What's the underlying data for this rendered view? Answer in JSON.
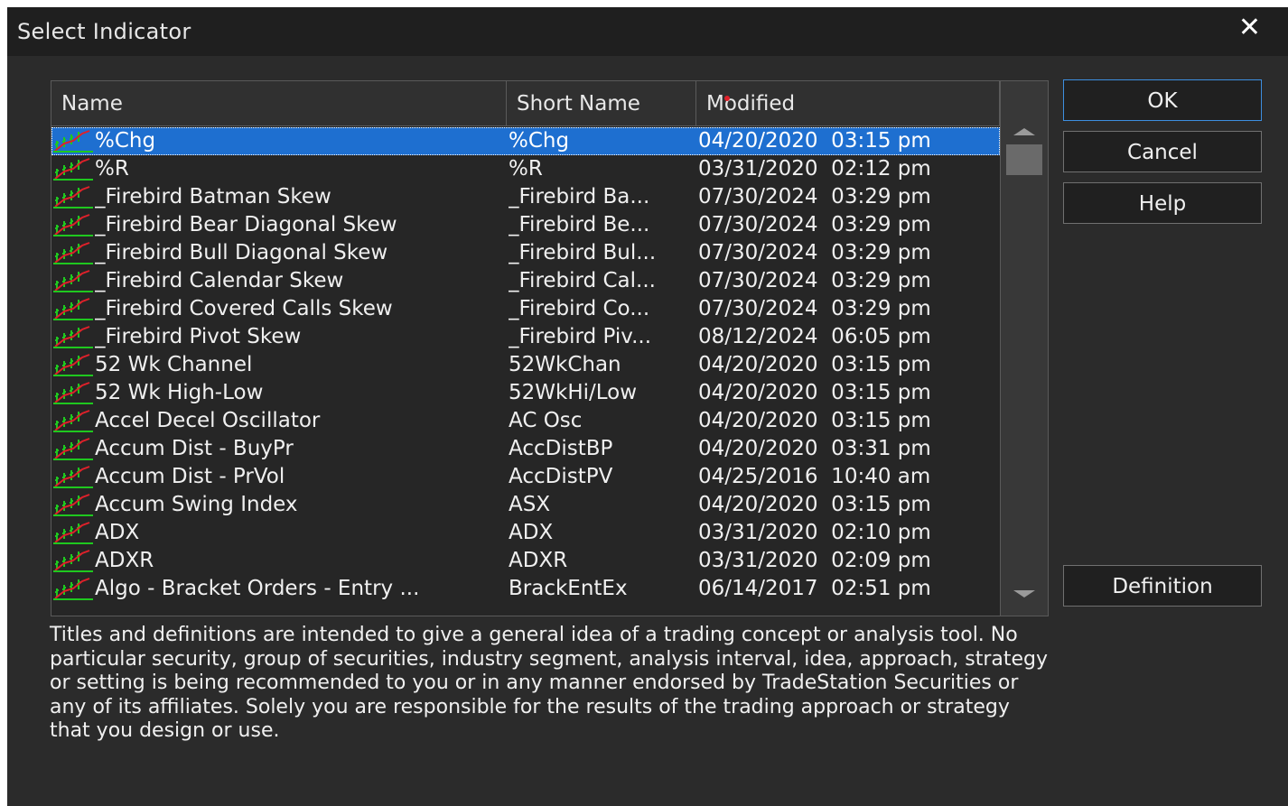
{
  "dialog": {
    "title": "Select Indicator",
    "close_glyph": "✕"
  },
  "columns": {
    "name": "Name",
    "short_name": "Short Name",
    "modified": "Modified"
  },
  "rows": [
    {
      "name": "%Chg",
      "short": "%Chg",
      "modified": "04/20/2020  03:15 pm",
      "selected": true
    },
    {
      "name": "%R",
      "short": "%R",
      "modified": "03/31/2020  02:12 pm"
    },
    {
      "name": "_Firebird Batman Skew",
      "short": "_Firebird Ba...",
      "modified": "07/30/2024  03:29 pm"
    },
    {
      "name": "_Firebird Bear Diagonal Skew",
      "short": "_Firebird Be...",
      "modified": "07/30/2024  03:29 pm"
    },
    {
      "name": "_Firebird Bull Diagonal Skew",
      "short": "_Firebird Bul...",
      "modified": "07/30/2024  03:29 pm"
    },
    {
      "name": "_Firebird Calendar Skew",
      "short": "_Firebird Cal...",
      "modified": "07/30/2024  03:29 pm"
    },
    {
      "name": "_Firebird Covered Calls Skew",
      "short": "_Firebird Co...",
      "modified": "07/30/2024  03:29 pm"
    },
    {
      "name": "_Firebird Pivot Skew",
      "short": "_Firebird Piv...",
      "modified": "08/12/2024  06:05 pm"
    },
    {
      "name": "52 Wk Channel",
      "short": "52WkChan",
      "modified": "04/20/2020  03:15 pm"
    },
    {
      "name": "52 Wk High-Low",
      "short": "52WkHi/Low",
      "modified": "04/20/2020  03:15 pm"
    },
    {
      "name": "Accel Decel Oscillator",
      "short": "AC Osc",
      "modified": "04/20/2020  03:15 pm"
    },
    {
      "name": "Accum Dist - BuyPr",
      "short": "AccDistBP",
      "modified": "04/20/2020  03:31 pm"
    },
    {
      "name": "Accum Dist - PrVol",
      "short": "AccDistPV",
      "modified": "04/25/2016  10:40 am"
    },
    {
      "name": "Accum Swing Index",
      "short": "ASX",
      "modified": "04/20/2020  03:15 pm"
    },
    {
      "name": "ADX",
      "short": "ADX",
      "modified": "03/31/2020  02:10 pm"
    },
    {
      "name": "ADXR",
      "short": "ADXR",
      "modified": "03/31/2020  02:09 pm"
    },
    {
      "name": "Algo - Bracket Orders - Entry ...",
      "short": "BrackEntEx",
      "modified": "06/14/2017  02:51 pm"
    }
  ],
  "buttons": {
    "ok": "OK",
    "cancel": "Cancel",
    "help": "Help",
    "definition": "Definition"
  },
  "disclaimer": "Titles and definitions are intended to give a general idea of a trading concept or analysis tool. No particular security, group of securities, industry segment, analysis interval, idea, approach, strategy or setting is being recommended to you or in any manner endorsed by TradeStation Securities or any of its affiliates. Solely you are responsible for the results of the trading approach or strategy that you design or use.",
  "icons": {
    "row_icon": "indicator-chart-icon",
    "close": "close-icon",
    "scroll_up": "scroll-up-arrow-icon",
    "scroll_down": "scroll-down-arrow-icon"
  },
  "colors": {
    "selection": "#1e6fd0",
    "background": "#2b2b2b",
    "titlebar": "#1f1f1f",
    "icon_green": "#1fc81f",
    "icon_red": "#e0202a"
  }
}
